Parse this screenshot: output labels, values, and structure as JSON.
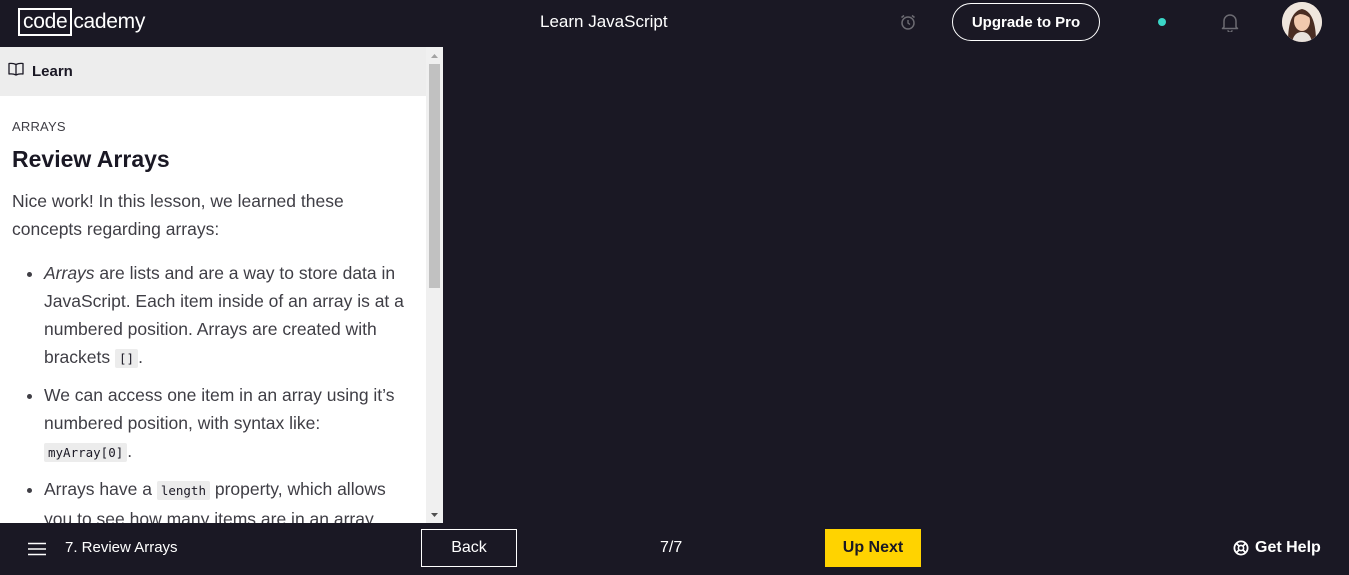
{
  "header": {
    "logo_boxed": "code",
    "logo_rest": "cademy",
    "course_title": "Learn JavaScript",
    "upgrade_label": "Upgrade to Pro",
    "status_dot_color": "#3ad6c7"
  },
  "panel": {
    "tab_label": "Learn",
    "eyebrow": "ARRAYS",
    "heading": "Review Arrays",
    "intro": "Nice work! In this lesson, we learned these concepts regarding arrays:",
    "bullets": [
      {
        "em": "Arrays",
        "text_a": " are lists and are a way to store data in JavaScript. Each item inside of an array is at a numbered position. Arrays are created with brackets ",
        "code": "[]",
        "text_b": "."
      },
      {
        "text_a": "We can access one item in an array using it’s numbered position, with syntax like: ",
        "code": "myArray[0]",
        "text_b": "."
      },
      {
        "text_a": "Arrays have a ",
        "code": "length",
        "text_b": " property, which allows you to see how many items are in an array."
      }
    ]
  },
  "footer": {
    "lesson_label": "7. Review Arrays",
    "back_label": "Back",
    "progress": "7/7",
    "next_label": "Up Next",
    "help_label": "Get Help",
    "accent_color": "#ffd300"
  },
  "icons": {
    "alarm": "alarm-clock-icon",
    "bell": "bell-icon",
    "book": "book-icon",
    "menu": "hamburger-menu-icon",
    "help": "lifebuoy-icon"
  }
}
